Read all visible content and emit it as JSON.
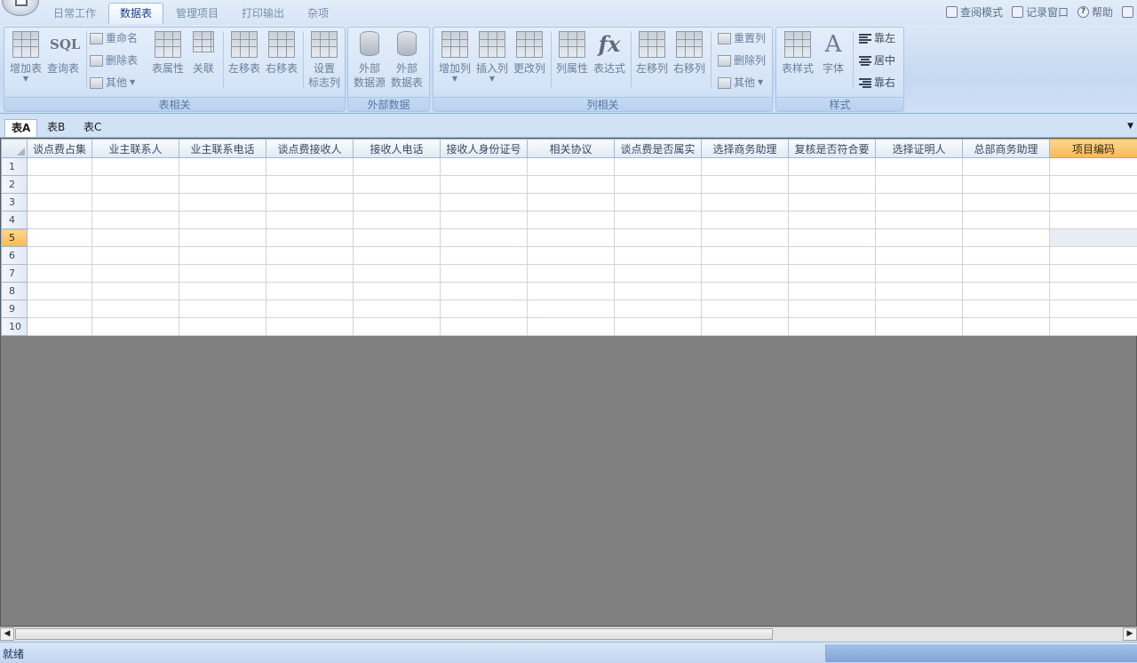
{
  "app": {
    "tabs": [
      {
        "label": "日常工作",
        "active": false
      },
      {
        "label": "数据表",
        "active": true
      },
      {
        "label": "管理项目",
        "active": false
      },
      {
        "label": "打印输出",
        "active": false
      },
      {
        "label": "杂项",
        "active": false
      }
    ],
    "topright": {
      "view_mode": "查阅模式",
      "record_window": "记录窗口",
      "help": "帮助"
    }
  },
  "ribbon": {
    "table_group": {
      "label": "表相关",
      "add_table": "增加表",
      "query_table": "查询表",
      "sql_icon": "SQL",
      "rename": "重命名",
      "delete_table": "删除表",
      "other": "其他",
      "table_props": "表属性",
      "relate": "关联",
      "move_left": "左移表",
      "move_right": "右移表",
      "set_flag_line1": "设置",
      "set_flag_line2": "标志列"
    },
    "external_group": {
      "label": "外部数据",
      "ext_source_line1": "外部",
      "ext_source_line2": "数据源",
      "ext_table_line1": "外部",
      "ext_table_line2": "数据表"
    },
    "column_group": {
      "label": "列相关",
      "add_column": "增加列",
      "insert_column": "插入列",
      "change_column": "更改列",
      "column_props": "列属性",
      "expression": "表达式",
      "fx_icon": "fx",
      "move_left": "左移列",
      "move_right": "右移列",
      "reset_column": "重置列",
      "delete_column": "删除列",
      "other": "其他"
    },
    "style_group": {
      "label": "样式",
      "table_style": "表样式",
      "font": "字体",
      "font_icon": "A",
      "align_left": "靠左",
      "align_center": "居中",
      "align_right": "靠右"
    }
  },
  "sheets": [
    {
      "label": "表A",
      "active": true
    },
    {
      "label": "表B",
      "active": false
    },
    {
      "label": "表C",
      "active": false
    }
  ],
  "grid": {
    "columns": [
      "谈点费占集",
      "业主联系人",
      "业主联系电话",
      "谈点费接收人",
      "接收人电话",
      "接收人身份证号",
      "相关协议",
      "谈点费是否属实",
      "选择商务助理",
      "复核是否符合要",
      "选择证明人",
      "总部商务助理",
      "项目编码"
    ],
    "rows": [
      "1",
      "2",
      "3",
      "4",
      "5",
      "6",
      "7",
      "8",
      "9",
      "10"
    ],
    "selected_row": "5",
    "selected_column": "项目编码"
  },
  "status": {
    "text": "就绪"
  }
}
